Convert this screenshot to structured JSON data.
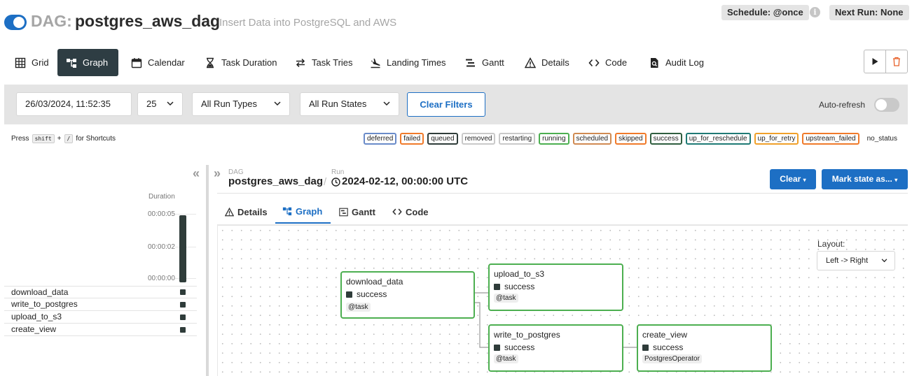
{
  "header": {
    "dag_prefix": "DAG:",
    "dag_id": "postgres_aws_dag",
    "description": "Insert Data into PostgreSQL and AWS",
    "schedule": "Schedule: @once",
    "next_run": "Next Run: None",
    "paused": false
  },
  "nav": {
    "tabs": [
      {
        "label": "Grid",
        "icon": "grid-icon",
        "active": false
      },
      {
        "label": "Graph",
        "icon": "graph-icon",
        "active": true
      },
      {
        "label": "Calendar",
        "icon": "calendar-icon",
        "active": false
      },
      {
        "label": "Task Duration",
        "icon": "hourglass-icon",
        "active": false
      },
      {
        "label": "Task Tries",
        "icon": "retry-icon",
        "active": false
      },
      {
        "label": "Landing Times",
        "icon": "landing-icon",
        "active": false
      },
      {
        "label": "Gantt",
        "icon": "gantt-icon",
        "active": false
      },
      {
        "label": "Details",
        "icon": "warning-icon",
        "active": false
      },
      {
        "label": "Code",
        "icon": "code-icon",
        "active": false
      },
      {
        "label": "Audit Log",
        "icon": "audit-log-icon",
        "active": false
      }
    ]
  },
  "filters": {
    "date": "26/03/2024, 11:52:35",
    "num_runs": "25",
    "run_types": "All Run Types",
    "run_states": "All Run States",
    "clear_label": "Clear Filters",
    "auto_refresh_label": "Auto-refresh",
    "auto_refresh_on": false
  },
  "shortcuts": {
    "press": "Press",
    "key1": "shift",
    "plus": "+",
    "key2": "/",
    "suffix": "for Shortcuts"
  },
  "legend": [
    {
      "label": "deferred",
      "color": "#6a8bc9"
    },
    {
      "label": "failed",
      "color": "#f07a2a"
    },
    {
      "label": "queued",
      "color": "#2f3c3a"
    },
    {
      "label": "removed",
      "color": "#c9c9c9"
    },
    {
      "label": "restarting",
      "color": "#c9c9c9"
    },
    {
      "label": "running",
      "color": "#4caf50"
    },
    {
      "label": "scheduled",
      "color": "#d08a52"
    },
    {
      "label": "skipped",
      "color": "#f07a2a"
    },
    {
      "label": "success",
      "color": "#2f5e3f"
    },
    {
      "label": "up_for_reschedule",
      "color": "#1f7a75"
    },
    {
      "label": "up_for_retry",
      "color": "#f0a02a"
    },
    {
      "label": "upstream_failed",
      "color": "#f07a2a"
    },
    {
      "label": "no_status",
      "color": null
    }
  ],
  "grid": {
    "duration_label": "Duration",
    "ticks": [
      "00:00:05",
      "00:00:02",
      "00:00:00"
    ],
    "tasks": [
      "download_data",
      "write_to_postgres",
      "upload_to_s3",
      "create_view"
    ]
  },
  "detail": {
    "dag_label": "DAG",
    "dag_id": "postgres_aws_dag",
    "run_label": "Run",
    "run_id": "2024-02-12, 00:00:00 UTC",
    "clear_label": "Clear",
    "mark_state_label": "Mark state as...",
    "tabs": [
      {
        "label": "Details",
        "icon": "warning-icon",
        "active": false
      },
      {
        "label": "Graph",
        "icon": "graph-icon",
        "active": true
      },
      {
        "label": "Gantt",
        "icon": "gantt-icon",
        "active": false
      },
      {
        "label": "Code",
        "icon": "code-icon",
        "active": false
      }
    ]
  },
  "graph": {
    "layout_label": "Layout:",
    "layout_value": "Left -> Right",
    "nodes": [
      {
        "name": "download_data",
        "state": "success",
        "operator": "@task"
      },
      {
        "name": "upload_to_s3",
        "state": "success",
        "operator": "@task"
      },
      {
        "name": "write_to_postgres",
        "state": "success",
        "operator": "@task"
      },
      {
        "name": "create_view",
        "state": "success",
        "operator": "PostgresOperator"
      }
    ],
    "edges": [
      [
        "download_data",
        "upload_to_s3"
      ],
      [
        "download_data",
        "write_to_postgres"
      ],
      [
        "write_to_postgres",
        "create_view"
      ]
    ]
  }
}
